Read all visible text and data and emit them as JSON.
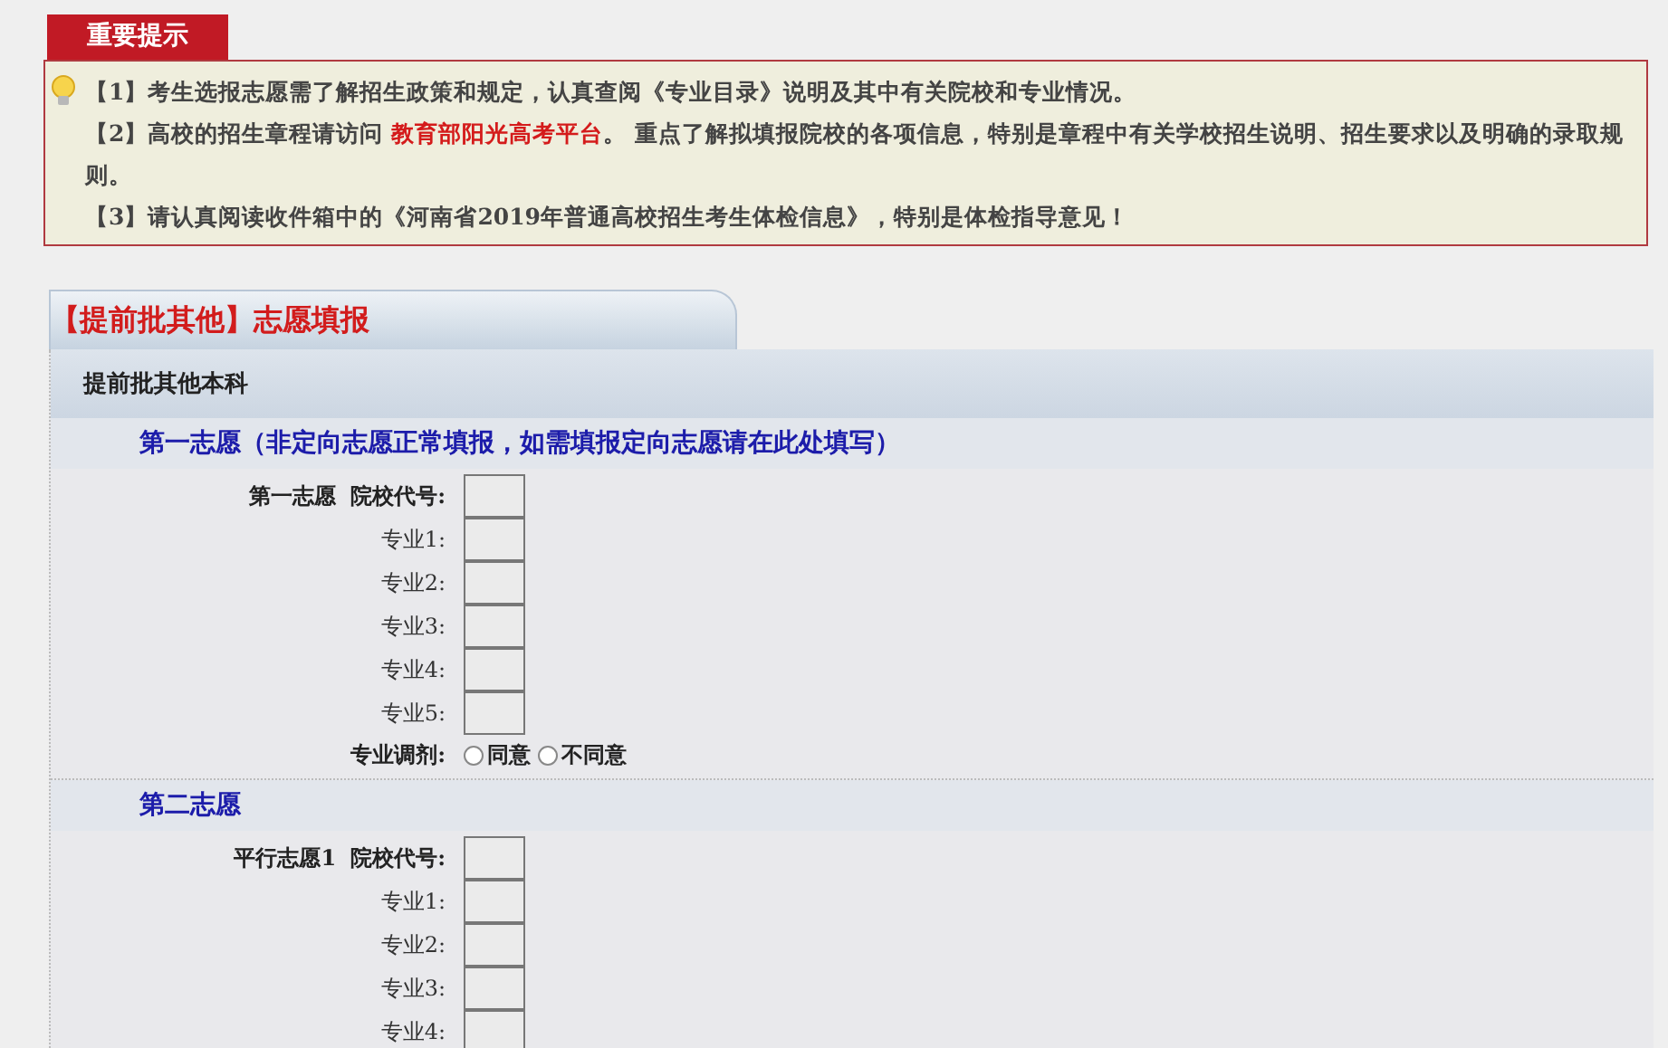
{
  "notice": {
    "tab": "重要提示",
    "items": [
      {
        "text": "【1】考生选报志愿需了解招生政策和规定，认真查阅《专业目录》说明及其中有关院校和专业情况。"
      },
      {
        "text": "【2】高校的招生章程请访问 ",
        "link": "教育部阳光高考平台",
        "after": "。 重点了解拟填报院校的各项信息，特别是章程中有关学校招生说明、招生要求以及明确的录取规则。"
      },
      {
        "text": "【3】请认真阅读收件箱中的《河南省2019年普通高校招生考生体检信息》，特别是体检指导意见！"
      }
    ]
  },
  "panel": {
    "tab_prefix": "【提前批其他】",
    "tab_title": "志愿填报",
    "subheader": "提前批其他本科",
    "sections": [
      {
        "title": "第一志愿（非定向志愿正常填报，如需填报定向志愿请在此处填写）",
        "choice": "第一志愿",
        "fields": [
          "院校代号:",
          "专业1:",
          "专业2:",
          "专业3:",
          "专业4:",
          "专业5:"
        ],
        "adjustment": {
          "label": "专业调剂:",
          "options": [
            {
              "label": "同意",
              "selected": false
            },
            {
              "label": "不同意",
              "selected": false
            }
          ]
        }
      },
      {
        "title": "第二志愿",
        "choice": "平行志愿1",
        "fields": [
          "院校代号:",
          "专业1:",
          "专业2:",
          "专业3:",
          "专业4:"
        ]
      }
    ]
  }
}
